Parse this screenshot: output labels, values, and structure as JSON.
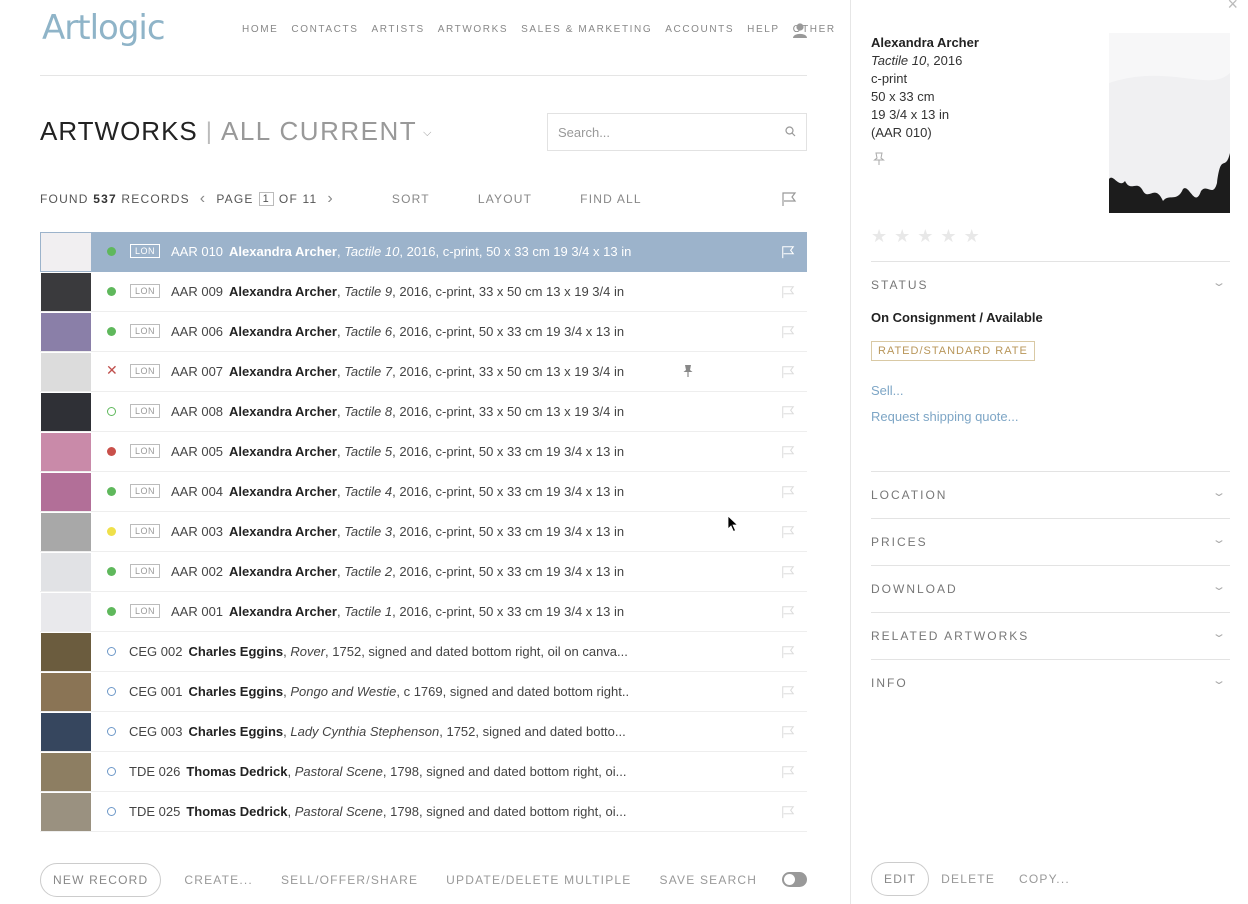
{
  "app": {
    "logo": "Artlogic"
  },
  "nav": [
    "HOME",
    "CONTACTS",
    "ARTISTS",
    "ARTWORKS",
    "SALES & MARKETING",
    "ACCOUNTS",
    "HELP",
    "OTHER"
  ],
  "header": {
    "title": "ARTWORKS",
    "separator": "|",
    "view": "ALL CURRENT"
  },
  "search": {
    "placeholder": "Search..."
  },
  "toolbar": {
    "found_prefix": "FOUND",
    "found_count": "537",
    "found_suffix": "RECORDS",
    "page_label": "PAGE",
    "page_value": "1",
    "page_of": "OF 11",
    "sort": "SORT",
    "layout": "LAYOUT",
    "find_all": "FIND ALL"
  },
  "rows": [
    {
      "ref": "AAR 010",
      "artist": "Alexandra Archer",
      "title": "Tactile 10",
      "rest": ", 2016, c-print, 50 x 33 cm 19 3/4 x 13 in",
      "loc": "LON",
      "status": "green",
      "thumb": "#f1eff1",
      "selected": true
    },
    {
      "ref": "AAR 009",
      "artist": "Alexandra Archer",
      "title": "Tactile 9",
      "rest": ", 2016, c-print, 33 x 50 cm 13 x 19 3/4 in",
      "loc": "LON",
      "status": "green",
      "thumb": "#3a3a3d"
    },
    {
      "ref": "AAR 006",
      "artist": "Alexandra Archer",
      "title": "Tactile 6",
      "rest": ", 2016, c-print, 50 x 33 cm 19 3/4 x 13 in",
      "loc": "LON",
      "status": "green",
      "thumb": "#8a7fa8"
    },
    {
      "ref": "AAR 007",
      "artist": "Alexandra Archer",
      "title": "Tactile 7",
      "rest": ", 2016, c-print, 33 x 50 cm 13 x 19 3/4 in",
      "loc": "LON",
      "status": "x",
      "thumb": "#dcdcdc",
      "pinned": true
    },
    {
      "ref": "AAR 008",
      "artist": "Alexandra Archer",
      "title": "Tactile 8",
      "rest": ", 2016, c-print, 33 x 50 cm 13 x 19 3/4 in",
      "loc": "LON",
      "status": "ring-green",
      "thumb": "#2f3036"
    },
    {
      "ref": "AAR 005",
      "artist": "Alexandra Archer",
      "title": "Tactile 5",
      "rest": ", 2016, c-print, 50 x 33 cm 19 3/4 x 13 in",
      "loc": "LON",
      "status": "red",
      "thumb": "#c98aa9"
    },
    {
      "ref": "AAR 004",
      "artist": "Alexandra Archer",
      "title": "Tactile 4",
      "rest": ", 2016, c-print, 50 x 33 cm 19 3/4 x 13 in",
      "loc": "LON",
      "status": "green",
      "thumb": "#b26f98"
    },
    {
      "ref": "AAR 003",
      "artist": "Alexandra Archer",
      "title": "Tactile 3",
      "rest": ", 2016, c-print, 50 x 33 cm 19 3/4 x 13 in",
      "loc": "LON",
      "status": "yellow",
      "thumb": "#a8a8a8"
    },
    {
      "ref": "AAR 002",
      "artist": "Alexandra Archer",
      "title": "Tactile 2",
      "rest": ", 2016, c-print, 50 x 33 cm 19 3/4 x 13 in",
      "loc": "LON",
      "status": "green",
      "thumb": "#e1e2e5"
    },
    {
      "ref": "AAR 001",
      "artist": "Alexandra Archer",
      "title": "Tactile 1",
      "rest": ", 2016, c-print, 50 x 33 cm 19 3/4 x 13 in",
      "loc": "LON",
      "status": "green",
      "thumb": "#e9e9ec"
    },
    {
      "ref": "CEG 002",
      "artist": "Charles Eggins",
      "title": "Rover",
      "rest": ", 1752, signed and dated bottom right, oil on canva...",
      "loc": "",
      "status": "ring-blue",
      "thumb": "#6b5c3e"
    },
    {
      "ref": "CEG 001",
      "artist": "Charles Eggins",
      "title": "Pongo and Westie",
      "rest": ", c 1769, signed and dated bottom right...",
      "loc": "",
      "status": "ring-blue",
      "thumb": "#8a7455"
    },
    {
      "ref": "CEG 003",
      "artist": "Charles Eggins",
      "title": "Lady Cynthia Stephenson",
      "rest": ", 1752, signed and dated botto...",
      "loc": "",
      "status": "ring-blue",
      "thumb": "#36465e"
    },
    {
      "ref": "TDE 026",
      "artist": "Thomas Dedrick",
      "title": "Pastoral Scene",
      "rest": ", 1798, signed and dated bottom right, oi...",
      "loc": "",
      "status": "ring-blue",
      "thumb": "#8d7e62"
    },
    {
      "ref": "TDE 025",
      "artist": "Thomas Dedrick",
      "title": "Pastoral Scene",
      "rest": ", 1798, signed and dated bottom right, oi...",
      "loc": "",
      "status": "ring-blue",
      "thumb": "#9a9180"
    }
  ],
  "bottombar": {
    "new_record": "NEW RECORD",
    "create": "CREATE...",
    "sell": "SELL/OFFER/SHARE",
    "update": "UPDATE/DELETE MULTIPLE",
    "save": "SAVE SEARCH"
  },
  "panel": {
    "artist": "Alexandra Archer",
    "title": "Tactile 10",
    "year": ", 2016",
    "medium": "c-print",
    "dims_cm": "50 x 33 cm",
    "dims_in": "19 3/4 x 13 in",
    "ref": "(AAR 010)",
    "sections": {
      "status": "STATUS",
      "location": "LOCATION",
      "prices": "PRICES",
      "download": "DOWNLOAD",
      "related": "RELATED ARTWORKS",
      "info": "INFO"
    },
    "status_value": "On Consignment / Available",
    "rate_badge": "RATED/STANDARD RATE",
    "sell_link": "Sell...",
    "ship_link": "Request shipping quote...",
    "edit": "EDIT",
    "delete": "DELETE",
    "copy": "COPY..."
  },
  "colors": {
    "selected_row": "#9cb3cb",
    "status_green": "#5fb85c",
    "status_red": "#c9504a",
    "status_yellow": "#efe04a",
    "status_blue": "#6d98c8",
    "link": "#7ea6c6"
  }
}
